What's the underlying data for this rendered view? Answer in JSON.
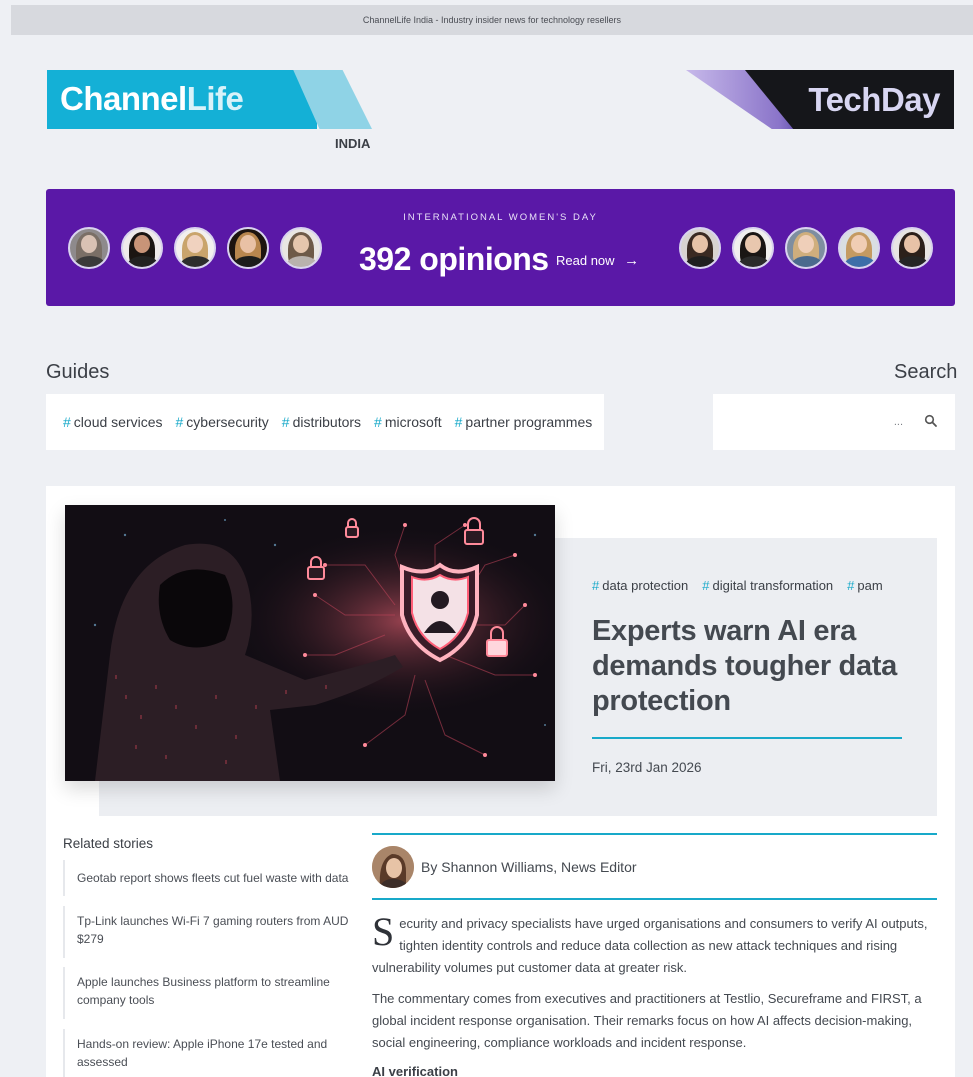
{
  "topbar": {
    "text": "ChannelLife India - Industry insider news for technology resellers"
  },
  "logos": {
    "channellife_a": "Channel",
    "channellife_b": "Life",
    "edition": "INDIA",
    "techday": "TechDay"
  },
  "banner": {
    "kicker": "INTERNATIONAL WOMEN'S DAY",
    "headline": "392 opinions",
    "cta": "Read now",
    "cta_icon": "arrow-right-icon"
  },
  "guides": {
    "title": "Guides",
    "tags": [
      "cloud services",
      "cybersecurity",
      "distributors",
      "microsoft",
      "partner programmes"
    ]
  },
  "search": {
    "title": "Search",
    "placeholder": "...",
    "icon": "search-icon"
  },
  "article": {
    "tags": [
      "data protection",
      "digital transformation",
      "pam"
    ],
    "headline": "Experts warn AI era demands tougher data protection",
    "date": "Fri, 23rd Jan 2026",
    "byline": "By Shannon Williams, News Editor",
    "dropcap": "S",
    "para1": "ecurity and privacy specialists have urged organisations and consumers to verify AI outputs, tighten identity controls and reduce data collection as new attack techniques and rising vulnerability volumes put customer data at greater risk.",
    "para2": "The commentary comes from executives and practitioners at Testlio, Secureframe and FIRST, a global incident response organisation. Their remarks focus on how AI affects decision-making, social engineering, compliance workloads and incident response.",
    "subhead": "AI verification"
  },
  "related": {
    "title": "Related stories",
    "items": [
      "Geotab report shows fleets cut fuel waste with data",
      "Tp-Link launches Wi-Fi 7 gaming routers from AUD $279",
      "Apple launches Business platform to streamline company tools",
      "Hands-on review: Apple iPhone 17e tested and assessed"
    ]
  },
  "colors": {
    "accent": "#18a9c9",
    "banner": "#5a18a7",
    "channellife_blue": "#14b0d6",
    "techday_dark": "#15161a"
  }
}
